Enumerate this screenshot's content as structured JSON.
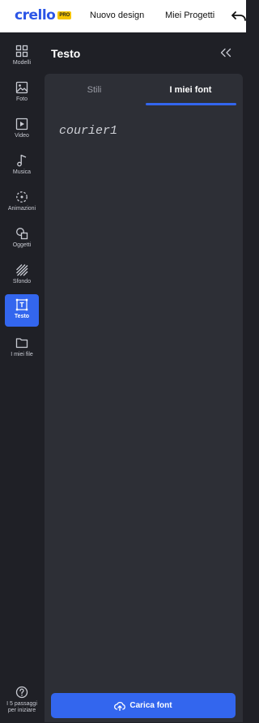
{
  "header": {
    "logo_text": "crello",
    "pro_badge": "PRO",
    "nav": {
      "new_design": "Nuovo design",
      "my_projects": "Miei Progetti"
    },
    "icons": {
      "undo": "undo-icon"
    }
  },
  "sidebar": {
    "items": [
      {
        "label": "Modelli",
        "icon": "templates-grid-icon"
      },
      {
        "label": "Foto",
        "icon": "photo-icon"
      },
      {
        "label": "Video",
        "icon": "video-icon"
      },
      {
        "label": "Musica",
        "icon": "music-note-icon"
      },
      {
        "label": "Animazioni",
        "icon": "animation-icon"
      },
      {
        "label": "Oggetti",
        "icon": "shapes-icon"
      },
      {
        "label": "Sfondo",
        "icon": "background-icon"
      },
      {
        "label": "Testo",
        "icon": "text-icon",
        "active": true
      },
      {
        "label": "I miei file",
        "icon": "folder-icon"
      }
    ],
    "help_label": "I 5 passaggi per iniziare"
  },
  "panel": {
    "title": "Testo",
    "tabs": [
      {
        "label": "Stili",
        "active": false
      },
      {
        "label": "I miei font",
        "active": true
      }
    ],
    "fonts": [
      "courier1"
    ],
    "upload_button": "Carica font"
  },
  "colors": {
    "accent": "#3366ee",
    "rail_bg": "#1f2026",
    "panel_bg": "#2d2f36",
    "brand": "#2b55e6",
    "pro_badge": "#f5c400"
  }
}
